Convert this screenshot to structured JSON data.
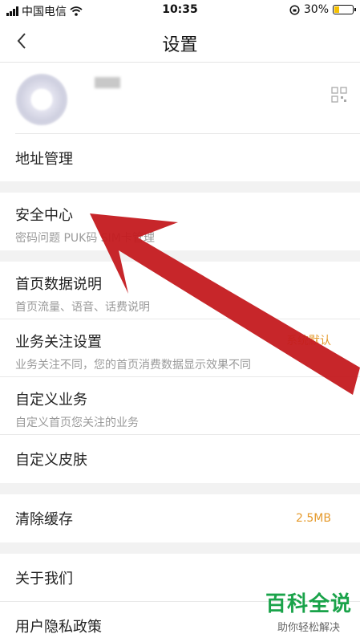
{
  "status_bar": {
    "carrier": "中国电信",
    "time": "10:35",
    "battery": "30%"
  },
  "nav": {
    "title": "设置"
  },
  "rows": {
    "address": {
      "label": "地址管理"
    },
    "security": {
      "label": "安全中心",
      "sub": "密码问题 PUK码 SIM卡管理"
    },
    "home_data": {
      "label": "首页数据说明",
      "sub": "首页流量、语音、话费说明"
    },
    "business_focus": {
      "label": "业务关注设置",
      "sub": "业务关注不同，您的首页消费数据显示效果不同",
      "value": "系统默认"
    },
    "custom_business": {
      "label": "自定义业务",
      "sub": "自定义首页您关注的业务"
    },
    "custom_skin": {
      "label": "自定义皮肤"
    },
    "clear_cache": {
      "label": "清除缓存",
      "value": "2.5MB"
    },
    "about": {
      "label": "关于我们"
    },
    "privacy": {
      "label": "用户隐私政策"
    }
  },
  "watermark": {
    "title": "百科全说",
    "subtitle": "助你轻松解决"
  },
  "colors": {
    "accent": "#e59a2c",
    "arrow": "#c41a1f",
    "watermark": "#1aa34a"
  }
}
